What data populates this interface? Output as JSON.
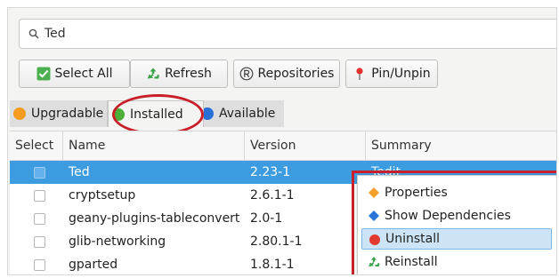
{
  "search": {
    "value": "Ted"
  },
  "toolbar": {
    "select_all": "Select All",
    "refresh": "Refresh",
    "repositories": "Repositories",
    "pin_unpin": "Pin/Unpin"
  },
  "tabs": [
    {
      "label": "Upgradable",
      "color": "#f39c1f"
    },
    {
      "label": "Installed",
      "color": "#4caf3a"
    },
    {
      "label": "Available",
      "color": "#2a6fd6"
    }
  ],
  "table": {
    "headers": [
      "Select",
      "Name",
      "Version",
      "Summary"
    ],
    "rows": [
      {
        "name": "Ted",
        "version": "2.23-1",
        "summary": "Tedit"
      },
      {
        "name": "cryptsetup",
        "version": "2.6.1-1",
        "summary": ""
      },
      {
        "name": "geany-plugins-tableconvert",
        "version": "2.0-1",
        "summary": ""
      },
      {
        "name": "glib-networking",
        "version": "2.80.1-1",
        "summary": ""
      },
      {
        "name": "gparted",
        "version": "1.8.1-1",
        "summary": ""
      }
    ]
  },
  "context_menu": {
    "items": [
      {
        "label": "Properties",
        "icon": "diamond-orange-icon"
      },
      {
        "label": "Show Dependencies",
        "icon": "diamond-blue-icon"
      },
      {
        "label": "Uninstall",
        "icon": "red-circle-icon"
      },
      {
        "label": "Reinstall",
        "icon": "recycle-icon"
      }
    ]
  },
  "colors": {
    "selection": "#3d9be0",
    "highlight": "#c8202a"
  }
}
